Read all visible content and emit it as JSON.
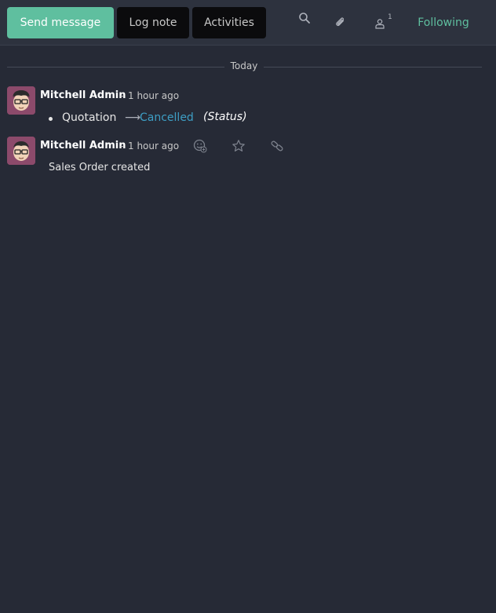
{
  "composer": {
    "send_message": "Send message",
    "log_note": "Log note",
    "activities": "Activities"
  },
  "toolbar": {
    "search_icon": "search-icon",
    "attachment_icon": "paperclip-icon",
    "followers_icon": "user-icon",
    "followers_count": "1",
    "following": "Following"
  },
  "separator": {
    "label": "Today"
  },
  "messages": [
    {
      "author": "Mitchell Admin",
      "separator": "-",
      "time": "1 hour ago",
      "tracking": {
        "field": "Quotation",
        "new_value": "Cancelled",
        "field_label": "(Status)"
      }
    },
    {
      "author": "Mitchell Admin",
      "separator": "-",
      "time": "1 hour ago",
      "body": "Sales Order created",
      "actions": [
        "add-reaction-icon",
        "star-icon",
        "link-icon"
      ]
    }
  ],
  "colors": {
    "background": "#262a36",
    "topbar": "#2d323e",
    "accent": "#5fbf9f",
    "tracking_value": "#3d9ec4"
  }
}
